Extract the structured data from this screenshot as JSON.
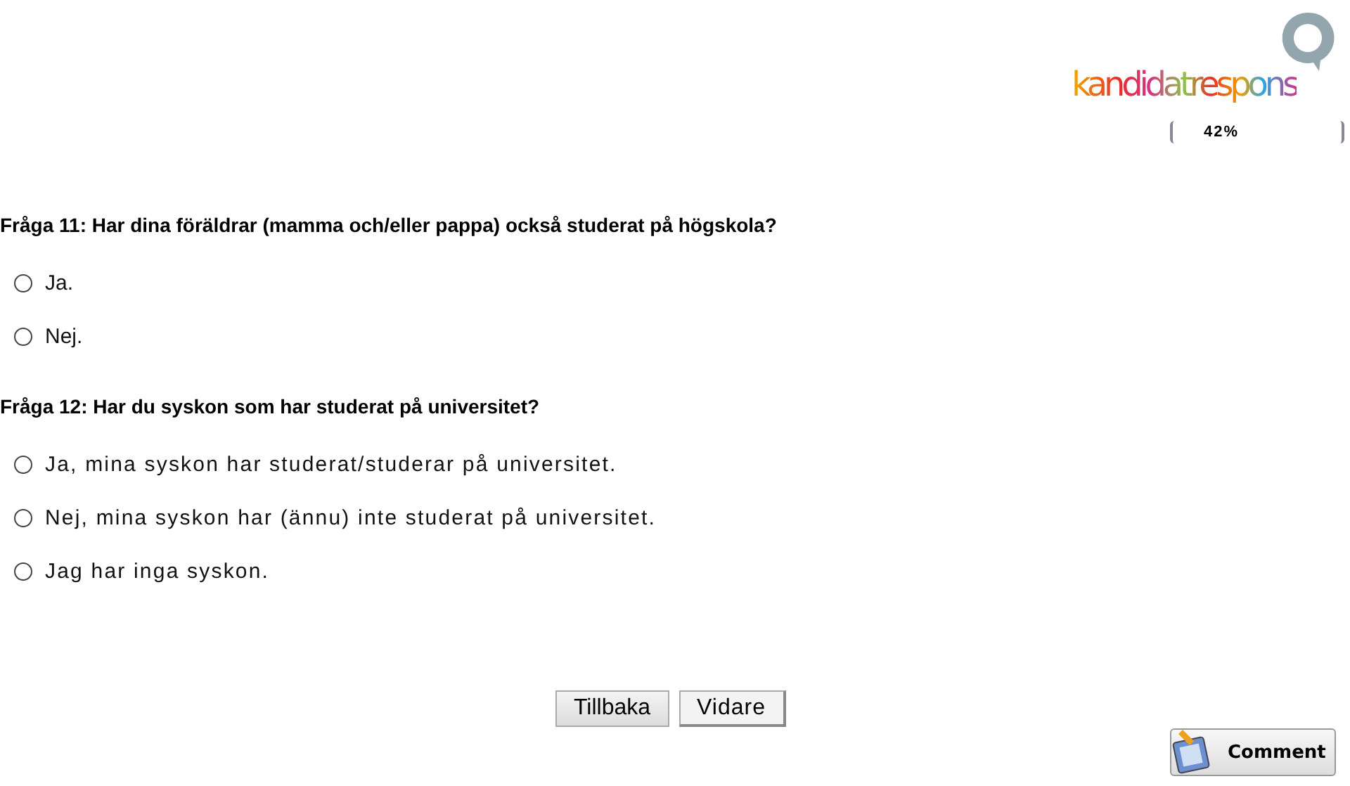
{
  "logo": {
    "text": "kandidatrespons"
  },
  "progress": {
    "label": "42%"
  },
  "questions": [
    {
      "title": "Fråga 11: Har dina föräldrar (mamma och/eller pappa) också studerat på högskola?",
      "spaced": false,
      "options": [
        {
          "label": "Ja.",
          "selected": false
        },
        {
          "label": "Nej.",
          "selected": false
        }
      ]
    },
    {
      "title": "Fråga 12: Har du syskon som har studerat på universitet?",
      "spaced": true,
      "options": [
        {
          "label": "Ja, mina syskon har studerat/studerar på universitet.",
          "selected": false
        },
        {
          "label": "Nej, mina syskon har (ännu) inte studerat på universitet.",
          "selected": false
        },
        {
          "label": "Jag har inga syskon.",
          "selected": false
        }
      ]
    }
  ],
  "buttons": [
    "Tillbaka",
    "Vidare"
  ],
  "comment_button": "Comment"
}
